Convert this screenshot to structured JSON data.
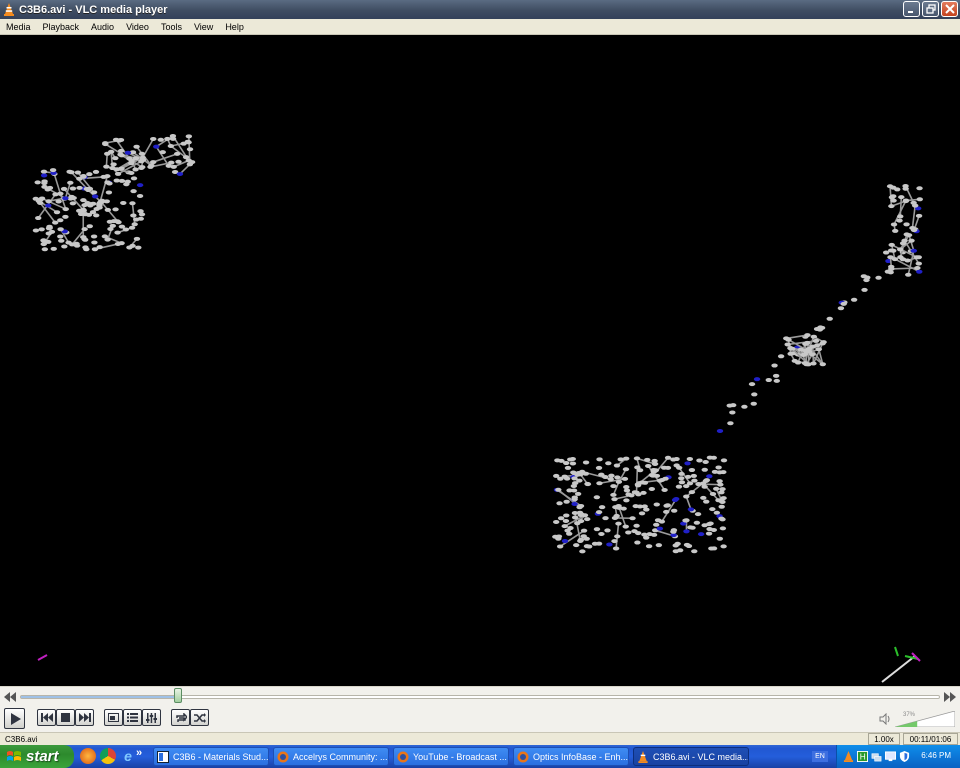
{
  "window": {
    "title": "C3B6.avi - VLC media player"
  },
  "menu": [
    "Media",
    "Playback",
    "Audio",
    "Video",
    "Tools",
    "View",
    "Help"
  ],
  "playback": {
    "progress": 0.1718,
    "volume_label": "37%",
    "rate": "1.00x",
    "time": "00:11/01:06",
    "file": "C3B6.avi"
  },
  "controls": {
    "icons": [
      "play-icon",
      "previous-icon",
      "stop-icon",
      "next-icon",
      "fullscreen-icon",
      "playlist-icon",
      "extended-settings-icon",
      "loop-icon",
      "shuffle-icon"
    ]
  },
  "taskbar": {
    "start_label": "start",
    "tasks": [
      {
        "label": "C3B6 - Materials Stud...",
        "icon": "materials-studio-icon"
      },
      {
        "label": "Accelrys Community: ...",
        "icon": "firefox-icon"
      },
      {
        "label": "YouTube - Broadcast ...",
        "icon": "firefox-icon"
      },
      {
        "label": "Optics InfoBase - Enh...",
        "icon": "firefox-icon"
      },
      {
        "label": "C3B6.avi - VLC media...",
        "icon": "vlc-icon"
      }
    ],
    "language": "EN",
    "clock": "6:46 PM"
  },
  "colors": {
    "titlebar": "#3f4d62",
    "taskbar": "#245edb",
    "start": "#3aa43a",
    "tray": "#0c77d8",
    "molecule_carbon": "#c8c8c8",
    "molecule_nitrogen": "#2020c8"
  }
}
